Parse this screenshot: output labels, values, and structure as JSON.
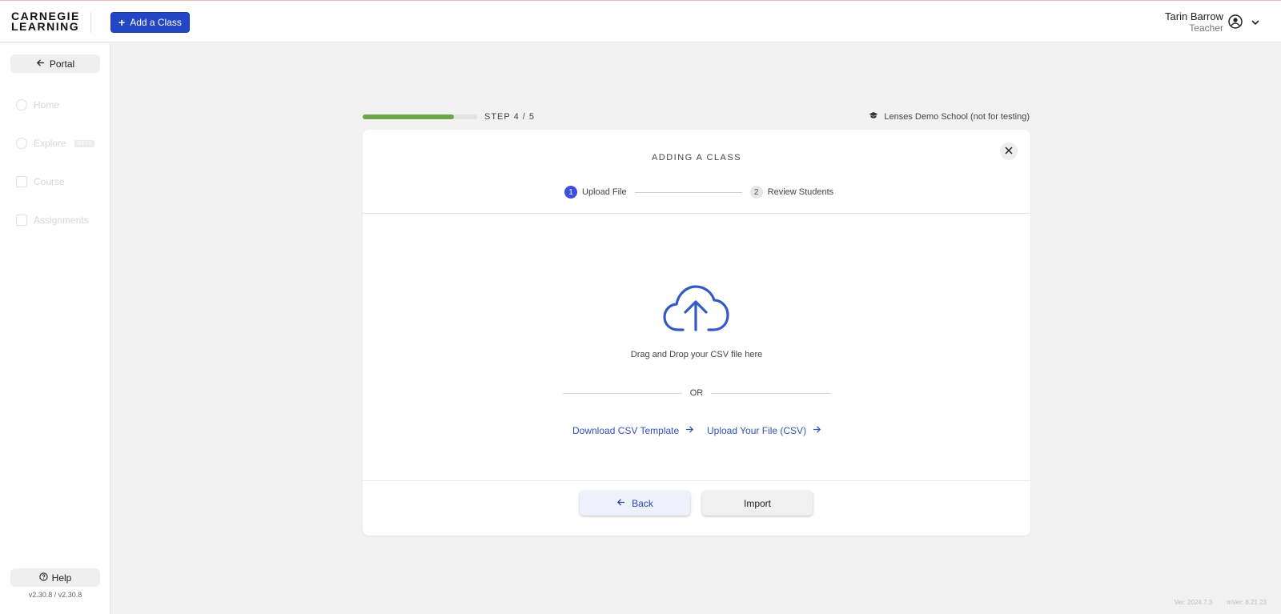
{
  "header": {
    "logo_line1": "CARNEGIE",
    "logo_line2": "LEARNING",
    "add_class_label": "Add a Class",
    "user_name": "Tarin Barrow",
    "user_role": "Teacher"
  },
  "sidebar": {
    "portal_label": "Portal",
    "items": [
      {
        "label": "Home",
        "icon": "home-icon"
      },
      {
        "label": "Explore",
        "icon": "search-icon",
        "badge": "BETA"
      },
      {
        "label": "Course",
        "icon": "course-icon"
      },
      {
        "label": "Assignments",
        "icon": "assignments-icon"
      }
    ],
    "help_label": "Help",
    "version": "v2.30.8 / v2.30.8"
  },
  "wizard": {
    "progress": 0.8,
    "step_label": "STEP 4 / 5",
    "school": "Lenses Demo School (not for testing)"
  },
  "card": {
    "title": "ADDING A CLASS",
    "steps": [
      {
        "number": "1",
        "label": "Upload File"
      },
      {
        "number": "2",
        "label": "Review Students"
      }
    ],
    "drop_text": "Drag and Drop your CSV file here",
    "or_text": "OR",
    "download_link": "Download CSV Template",
    "upload_link": "Upload Your File (CSV)",
    "back_label": "Back",
    "import_label": "Import"
  },
  "footer": {
    "ver": "Ver: 2024.7.3",
    "mver": "mVer: 8.21.23"
  },
  "colors": {
    "accent": "#2346c4",
    "progress": "#6ea54a",
    "link": "#3452b8"
  }
}
